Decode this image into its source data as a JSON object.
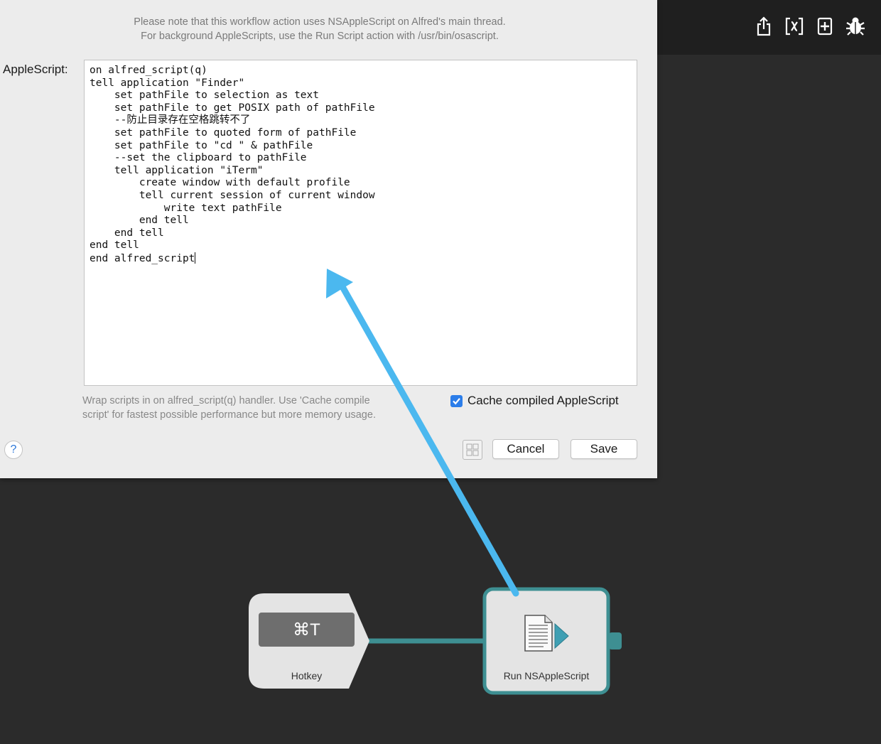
{
  "dialog": {
    "note_line1": "Please note that this workflow action uses NSAppleScript on Alfred's main thread.",
    "note_line2": "For background AppleScripts, use the Run Script action with /usr/bin/osascript.",
    "applescript_label": "AppleScript:",
    "code": "on alfred_script(q)\ntell application \"Finder\"\n    set pathFile to selection as text\n    set pathFile to get POSIX path of pathFile\n    --防止目录存在空格跳转不了\n    set pathFile to quoted form of pathFile\n    set pathFile to \"cd \" & pathFile\n    --set the clipboard to pathFile\n    tell application \"iTerm\"\n        create window with default profile\n        tell current session of current window\n            write text pathFile\n        end tell\n    end tell\nend tell\nend alfred_script",
    "hint_line1": "Wrap scripts in on alfred_script(q) handler. Use 'Cache compile",
    "hint_line2": "script' for fastest possible performance but more memory usage.",
    "cache_label": "Cache compiled AppleScript",
    "cache_checked": true,
    "help_label": "?",
    "cancel_label": "Cancel",
    "save_label": "Save"
  },
  "toolbar": {
    "icons": [
      "share-icon",
      "variables-icon",
      "add-icon",
      "debug-icon"
    ]
  },
  "canvas": {
    "hotkey_node": {
      "key": "⌘T",
      "label": "Hotkey"
    },
    "script_node": {
      "label": "Run NSAppleScript"
    }
  },
  "colors": {
    "connection": "#3e8f92",
    "arrow": "#4bb8ef",
    "checkbox": "#2b7de9",
    "canvas_bg": "#2b2b2b"
  }
}
